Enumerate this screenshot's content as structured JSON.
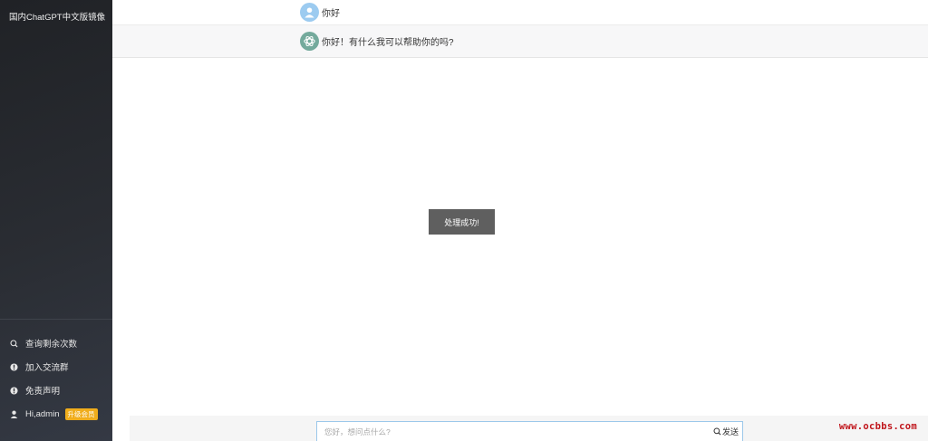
{
  "sidebar": {
    "app_title": "国内ChatGPT中文版镜像",
    "items": [
      {
        "label": "查询剩余次数",
        "icon": "search-icon"
      },
      {
        "label": "加入交流群",
        "icon": "info-icon"
      },
      {
        "label": "免责声明",
        "icon": "info-icon"
      },
      {
        "label": "Hi,admin",
        "icon": "user-icon",
        "badge": "升级会员"
      }
    ]
  },
  "messages": [
    {
      "role": "user",
      "text": "你好",
      "avatar_icon": "user-avatar-icon"
    },
    {
      "role": "assistant",
      "text": "你好！有什么我可以帮助你的吗?",
      "avatar_icon": "openai-logo-icon"
    }
  ],
  "toast": {
    "text": "处理成功!"
  },
  "input": {
    "placeholder": "您好，想问点什么?",
    "value": "",
    "send_label": "发送",
    "send_icon": "search-icon"
  },
  "watermark": {
    "text": "www.ocbbs.com"
  },
  "colors": {
    "sidebar_bg": "#2a2d33",
    "badge": "#f0ad1c",
    "input_border": "#9cc8ea",
    "toast_bg": "#5f5f5f",
    "bot_avatar": "#74aa9c",
    "user_avatar": "#9ccbf0",
    "watermark": "#c0151b"
  }
}
